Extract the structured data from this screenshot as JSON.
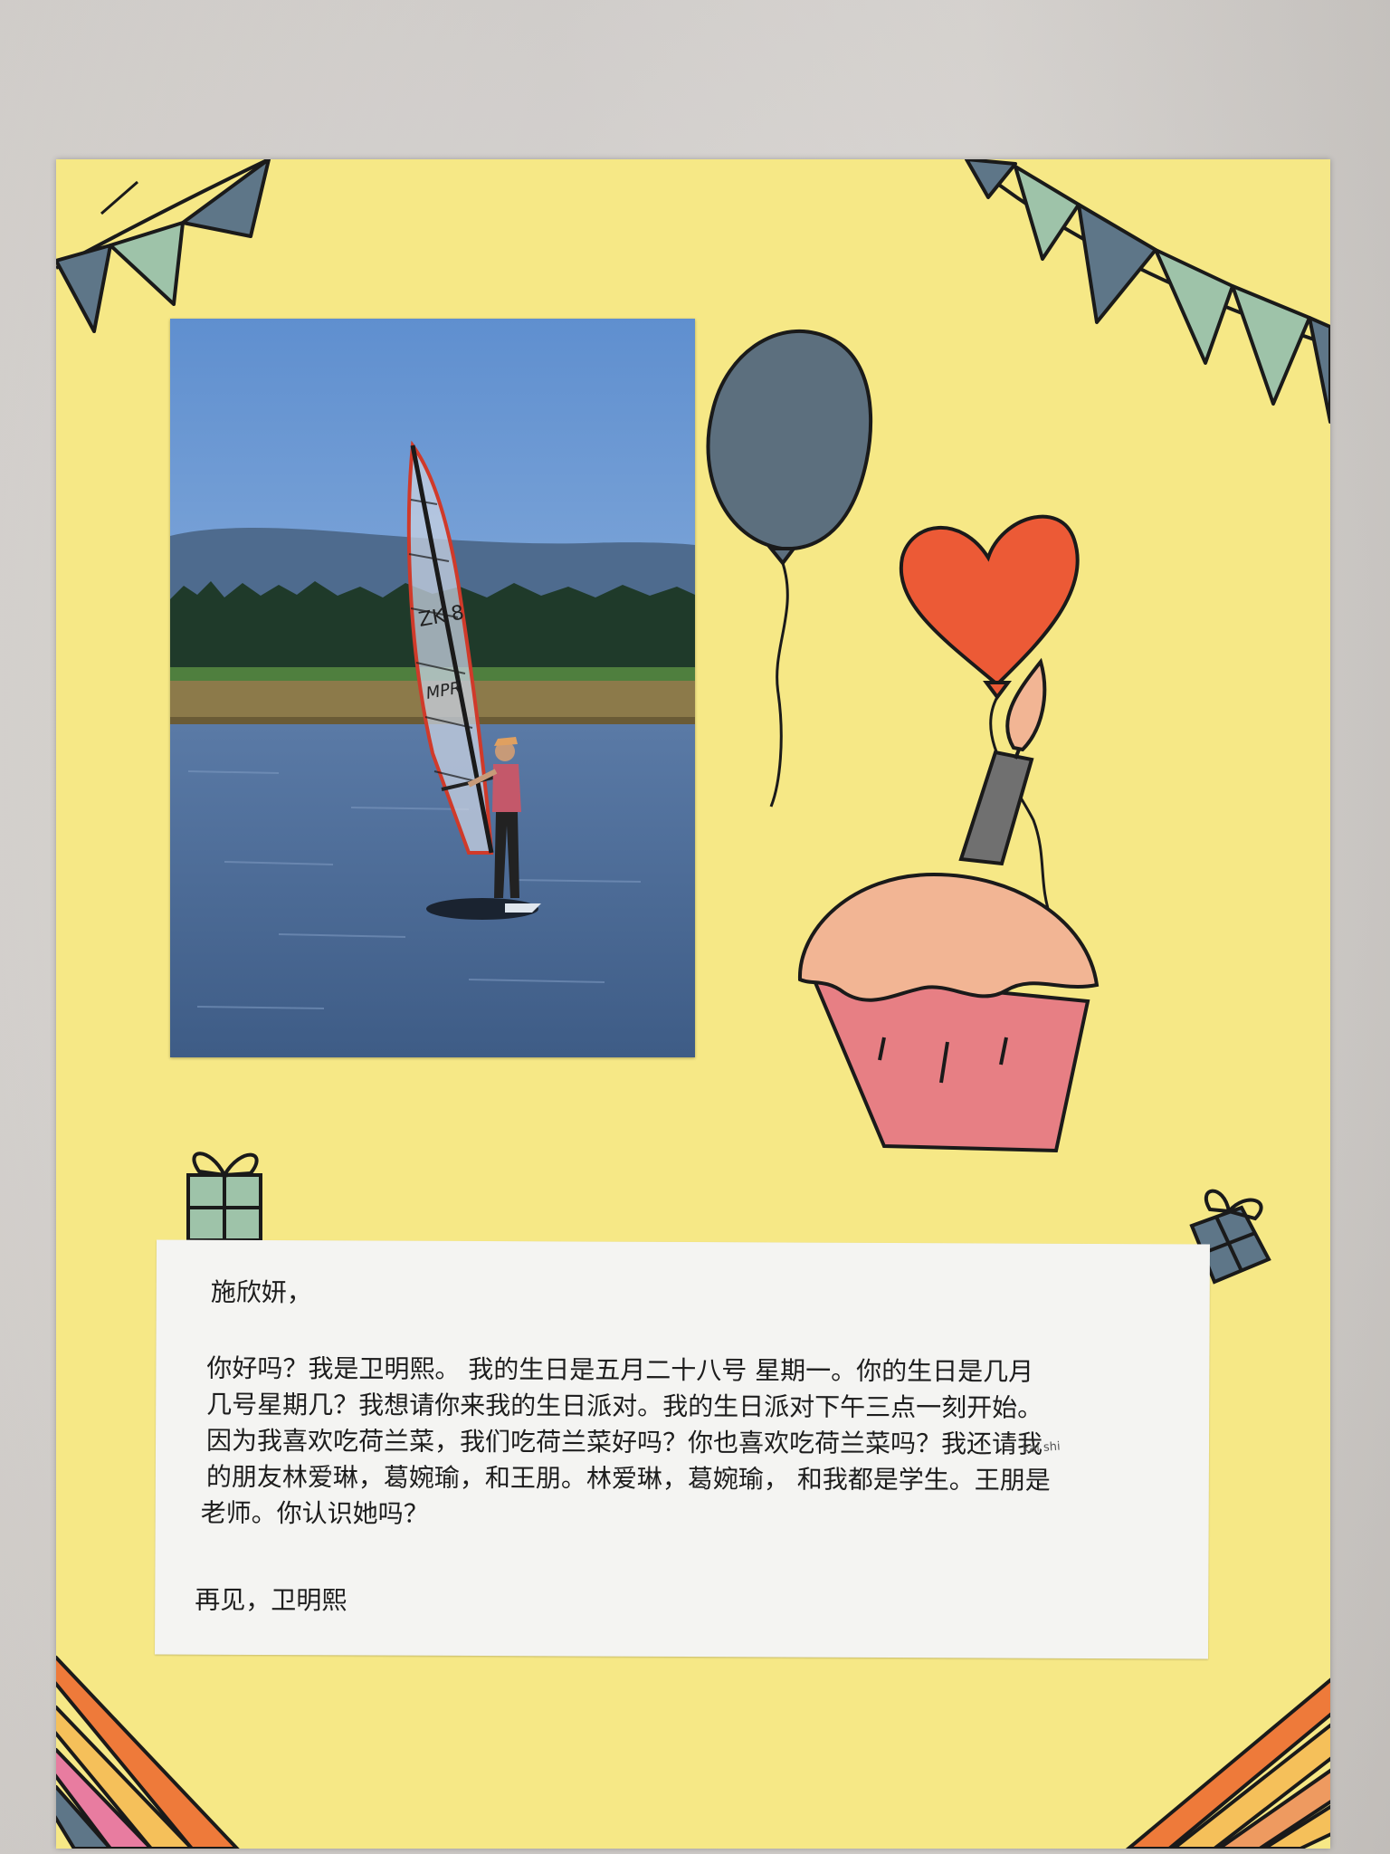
{
  "letter": {
    "greeting": "施欣妍，",
    "lines": [
      "你好吗？我是卫明熙。 我的生日是五月二十八号 星期一。你的生日是几月",
      "几号星期几？我想请你来我的生日派对。我的生日派对下午三点一刻开始。",
      "因为我喜欢吃荷兰菜，我们吃荷兰菜好吗？你也喜欢吃荷兰菜吗？我还请我",
      "的朋友林爱琳，葛婉瑜，和王朋。林爱琳，葛婉瑜， 和我都是学生。王朋是",
      "老师。你认识她吗？"
    ],
    "signoff": "再见，卫明熙",
    "pencil_note": "kai shi"
  },
  "photo": {
    "sail_text": "MPR",
    "sail_number": "ZK 8"
  },
  "colors": {
    "poster": "#f6e886",
    "balloon_blue": "#5c6f7e",
    "heart": "#ec5a36",
    "cupcake_top": "#f2b594",
    "cupcake_base": "#e77f84",
    "candle": "#707070",
    "flag_green": "#9ec3a9",
    "flag_blue": "#5e7688"
  },
  "icons": [
    "bunting-flags",
    "balloon",
    "heart-balloon",
    "cupcake",
    "candle",
    "gift-box",
    "rainbow-stripes"
  ]
}
